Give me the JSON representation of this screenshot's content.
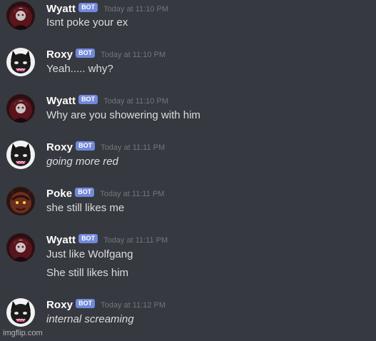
{
  "messages": [
    {
      "username": "Wyatt",
      "bot_tag": "BOT",
      "timestamp": "Today at 11:10 PM",
      "avatar": "wyatt-avatar-icon",
      "lines": [
        {
          "text": "Isnt poke your ex",
          "italic": false
        }
      ]
    },
    {
      "username": "Roxy",
      "bot_tag": "BOT",
      "timestamp": "Today at 11:10 PM",
      "avatar": "roxy-avatar-icon",
      "lines": [
        {
          "text": "Yeah..... why?",
          "italic": false
        }
      ]
    },
    {
      "username": "Wyatt",
      "bot_tag": "BOT",
      "timestamp": "Today at 11:10 PM",
      "avatar": "wyatt-avatar-icon",
      "lines": [
        {
          "text": "Why are you showering with him",
          "italic": false
        }
      ]
    },
    {
      "username": "Roxy",
      "bot_tag": "BOT",
      "timestamp": "Today at 11:11 PM",
      "avatar": "roxy-avatar-icon",
      "lines": [
        {
          "text": "going more red",
          "italic": true
        }
      ]
    },
    {
      "username": "Poke",
      "bot_tag": "BOT",
      "timestamp": "Today at 11:11 PM",
      "avatar": "poke-avatar-icon",
      "lines": [
        {
          "text": "she still likes me",
          "italic": false
        }
      ]
    },
    {
      "username": "Wyatt",
      "bot_tag": "BOT",
      "timestamp": "Today at 11:11 PM",
      "avatar": "wyatt-avatar-icon",
      "lines": [
        {
          "text": "Just like Wolfgang",
          "italic": false
        },
        {
          "text": "She still likes him",
          "italic": false
        }
      ]
    },
    {
      "username": "Roxy",
      "bot_tag": "BOT",
      "timestamp": "Today at 11:12 PM",
      "avatar": "roxy-avatar-icon",
      "lines": [
        {
          "text": "internal screaming",
          "italic": true
        }
      ]
    }
  ],
  "watermark": "imgflip.com",
  "colors": {
    "background": "#36393f",
    "username": "#ffffff",
    "bot_tag": "#7289da",
    "timestamp": "#72767d",
    "message_text": "#dcddde"
  }
}
